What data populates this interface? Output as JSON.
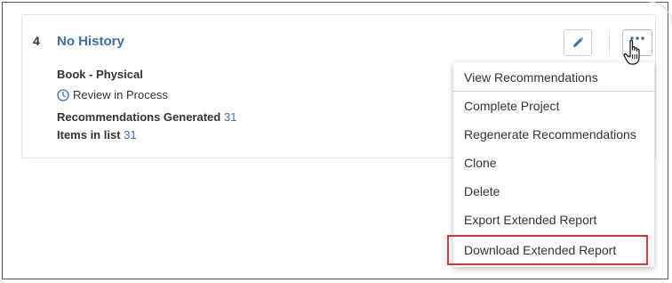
{
  "record": {
    "index": "4",
    "title": "No History",
    "format": "Book - Physical",
    "status": "Review in Process",
    "recommendations_label": "Recommendations Generated",
    "recommendations_count": "31",
    "items_label": "Items in list",
    "items_count": "31"
  },
  "actions": {
    "edit_icon": "pencil-icon",
    "more_icon": "ellipsis-icon"
  },
  "menu": {
    "items": [
      "View Recommendations",
      "Complete Project",
      "Regenerate Recommendations",
      "Clone",
      "Delete",
      "Export Extended Report",
      "Download Extended Report"
    ],
    "highlighted": "Download Extended Report"
  },
  "colors": {
    "link": "#3d6ea8",
    "highlight_border": "#d83535",
    "text": "#333333"
  }
}
